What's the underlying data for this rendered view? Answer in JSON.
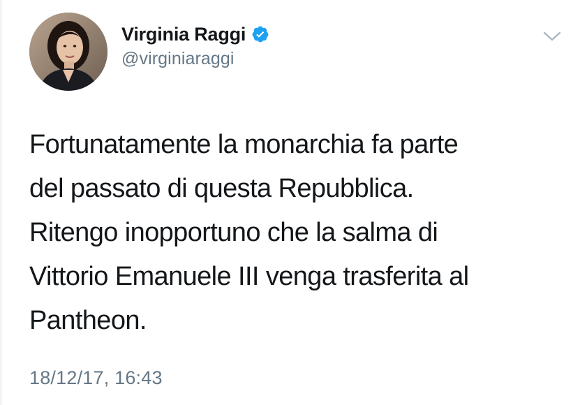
{
  "user": {
    "display_name": "Virginia Raggi",
    "handle": "@virginiaraggi",
    "verified": true,
    "avatar_icon": "profile-photo"
  },
  "tweet": {
    "text": "Fortunatamente la monarchia fa parte\ndel passato di questa Repubblica.\nRitengo inopportuno che la salma di\nVittorio Emanuele III venga trasferita al\nPantheon.",
    "timestamp": "18/12/17, 16:43"
  },
  "icons": {
    "verified": "verified-badge-icon",
    "menu": "chevron-down-icon"
  },
  "colors": {
    "text": "#14171a",
    "secondary": "#657786",
    "verified_badge": "#1da1f2",
    "chevron": "#aab8c2"
  }
}
